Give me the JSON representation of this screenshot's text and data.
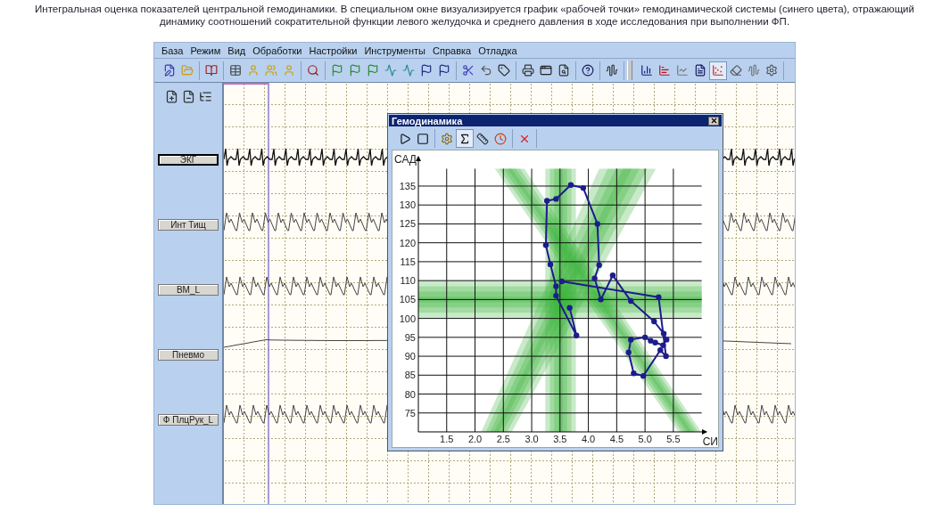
{
  "caption": "Интегральная оценка показателей центральной гемодинамики. В специальном окне визуализируется график «рабочей точки» гемодинамической системы (синего цвета), отражающий динамику соотношений сократительной функции левого желудочка и среднего давления в ходе исследования при выполнении ФП.",
  "menu": [
    "База",
    "Режим",
    "Вид",
    "Обработки",
    "Настройки",
    "Инструменты",
    "Справка",
    "Отладка"
  ],
  "toolbar": [
    [
      {
        "selected": false
      },
      {
        "selected": false
      }
    ],
    [
      {
        "selected": false
      }
    ],
    [
      {
        "selected": false
      },
      {
        "selected": false
      },
      {
        "selected": false
      },
      {
        "selected": false
      }
    ],
    [
      {
        "selected": false
      }
    ],
    [
      {
        "selected": false
      },
      {
        "selected": false
      },
      {
        "selected": false
      },
      {
        "selected": false
      },
      {
        "selected": false
      },
      {
        "selected": false
      },
      {
        "selected": false
      }
    ],
    [
      {
        "selected": false
      },
      {
        "selected": false
      },
      {
        "selected": false
      }
    ],
    [
      {
        "selected": false
      },
      {
        "selected": false
      },
      {
        "selected": false
      }
    ],
    [
      {
        "selected": false
      }
    ],
    [
      {
        "selected": false
      }
    ],
    [
      {
        "selected": false
      },
      {
        "selected": false
      },
      {
        "selected": false
      },
      {
        "selected": false
      },
      {
        "selected": true
      },
      {
        "selected": false
      },
      {
        "selected": false
      },
      {
        "selected": false
      }
    ]
  ],
  "channels": [
    {
      "label": "ЭКГ",
      "kind": "ecg",
      "selected": true
    },
    {
      "label": "Инт Тищ",
      "kind": "pulse",
      "selected": false
    },
    {
      "label": "ВМ_L",
      "kind": "pulse",
      "selected": false
    },
    {
      "label": "Пневмо",
      "kind": "resp",
      "selected": false
    },
    {
      "label": "Ф ПлцРук_L",
      "kind": "pulse",
      "selected": false
    }
  ],
  "hemodynamics_window": {
    "title": "Гемодинамика",
    "toolbar": [
      [
        {
          "selected": false
        },
        {
          "selected": false
        }
      ],
      [
        {
          "selected": false
        },
        {
          "selected": true
        },
        {
          "selected": false
        },
        {
          "selected": false
        }
      ],
      [
        {
          "selected": false
        }
      ]
    ],
    "chart_data": {
      "type": "line",
      "xlabel": "СИ",
      "ylabel": "САД",
      "xlim": [
        1,
        6.1
      ],
      "ylim": [
        70,
        143
      ],
      "grid": true,
      "xticks": [
        {
          "value": 1.5,
          "label": "1.5"
        },
        {
          "value": 2,
          "label": "2.0"
        },
        {
          "value": 2.5,
          "label": "2.5"
        },
        {
          "value": 3,
          "label": "3.0"
        },
        {
          "value": 3.5,
          "label": "3.5"
        },
        {
          "value": 4,
          "label": "4.0"
        },
        {
          "value": 4.5,
          "label": "4.5"
        },
        {
          "value": 5,
          "label": "5.0"
        },
        {
          "value": 5.5,
          "label": "5.5"
        }
      ],
      "yticks": [
        75,
        80,
        85,
        90,
        95,
        100,
        105,
        110,
        115,
        120,
        125,
        130,
        135
      ],
      "x": [
        3.67,
        3.79,
        3.43,
        3.43,
        3.33,
        3.25,
        3.27,
        3.43,
        3.69,
        3.91,
        4.16,
        4.19,
        4.11,
        4.22,
        4.43,
        4.75,
        5.16,
        5.33,
        5.38,
        5.32,
        5.18,
        5.1,
        5.0,
        4.75,
        4.71,
        4.8,
        4.97,
        5.27,
        5.37,
        5.24,
        3.53
      ],
      "series": [
        {
          "color": "#1c1c8c",
          "marker": "o",
          "values": [
            102.8,
            95.5,
            106,
            108.5,
            114.3,
            119.4,
            131.1,
            131.6,
            135.3,
            134.5,
            125,
            114.1,
            110.6,
            105,
            111.4,
            104.6,
            99.2,
            96,
            94.4,
            92.9,
            93.6,
            94.1,
            95,
            94.4,
            91,
            85.5,
            84.8,
            91.6,
            90,
            105.6,
            109.8
          ]
        }
      ]
    }
  }
}
